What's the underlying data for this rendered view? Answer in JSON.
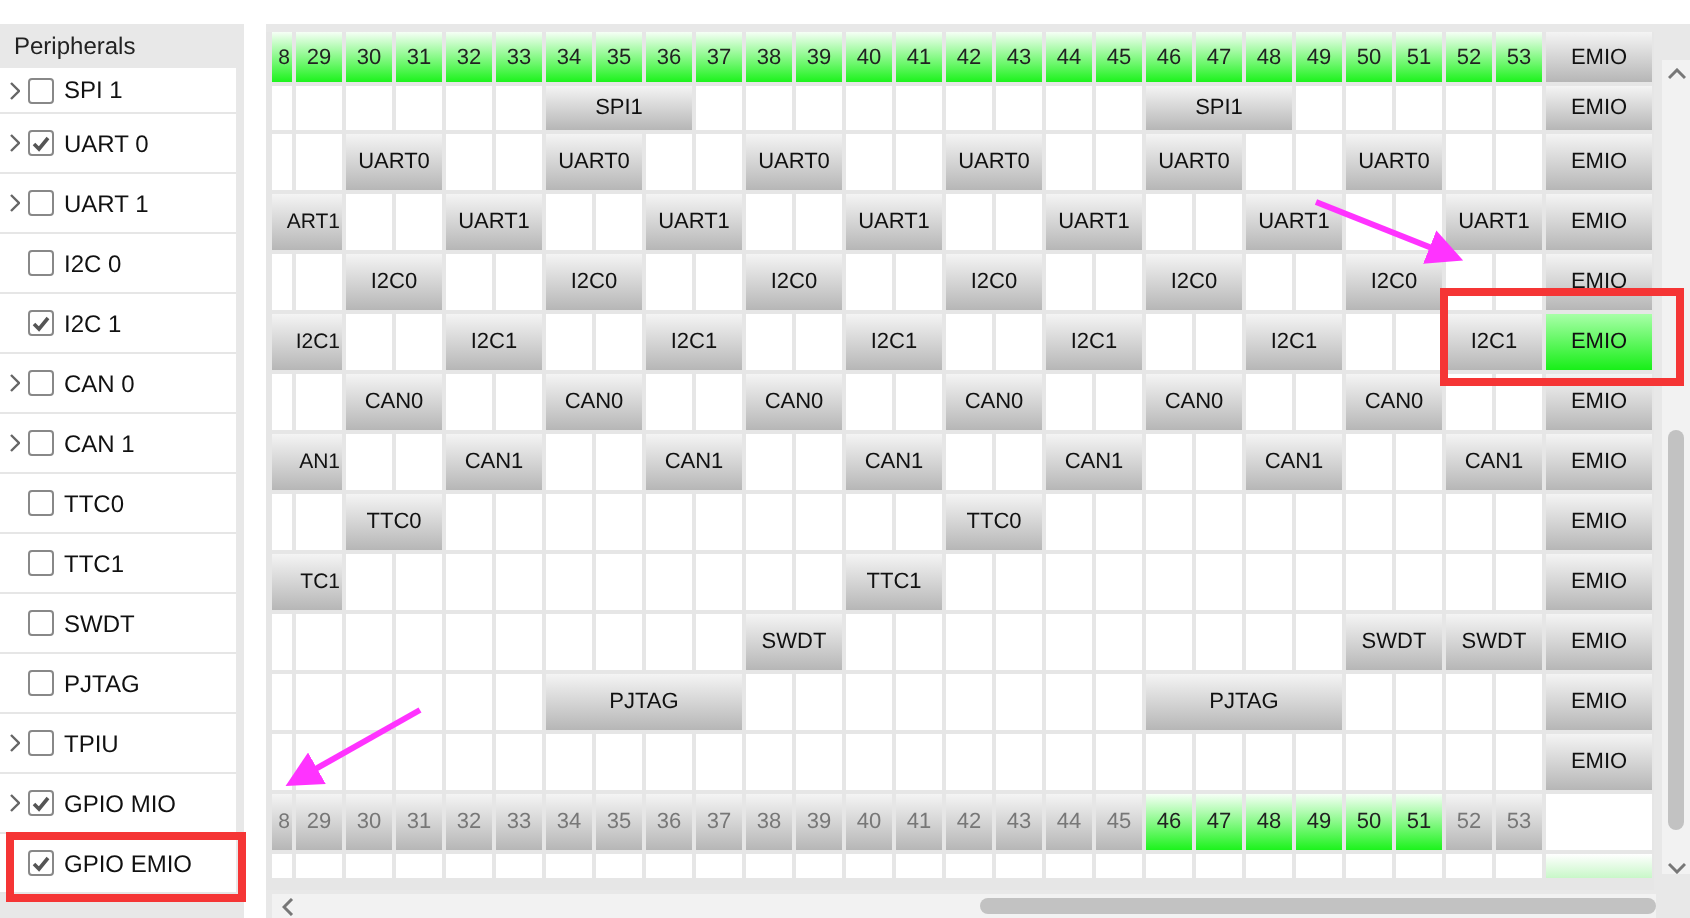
{
  "peripherals": {
    "title": "Peripherals",
    "items": [
      {
        "label": "SPI 1",
        "expandable": true,
        "checked": false
      },
      {
        "label": "UART 0",
        "expandable": true,
        "checked": true
      },
      {
        "label": "UART 1",
        "expandable": true,
        "checked": false
      },
      {
        "label": "I2C 0",
        "expandable": false,
        "checked": false
      },
      {
        "label": "I2C 1",
        "expandable": false,
        "checked": true
      },
      {
        "label": "CAN 0",
        "expandable": true,
        "checked": false
      },
      {
        "label": "CAN 1",
        "expandable": true,
        "checked": false
      },
      {
        "label": "TTC0",
        "expandable": false,
        "checked": false
      },
      {
        "label": "TTC1",
        "expandable": false,
        "checked": false
      },
      {
        "label": "SWDT",
        "expandable": false,
        "checked": false
      },
      {
        "label": "PJTAG",
        "expandable": false,
        "checked": false
      },
      {
        "label": "TPIU",
        "expandable": true,
        "checked": false
      },
      {
        "label": "GPIO MIO",
        "expandable": true,
        "checked": true
      },
      {
        "label": "GPIO EMIO",
        "expandable": false,
        "checked": true
      }
    ]
  },
  "pin_grid": {
    "top_pins": [
      {
        "label": "8",
        "active": true
      },
      {
        "label": "29",
        "active": true
      },
      {
        "label": "30",
        "active": true
      },
      {
        "label": "31",
        "active": true
      },
      {
        "label": "32",
        "active": true
      },
      {
        "label": "33",
        "active": true
      },
      {
        "label": "34",
        "active": true
      },
      {
        "label": "35",
        "active": true
      },
      {
        "label": "36",
        "active": true
      },
      {
        "label": "37",
        "active": true
      },
      {
        "label": "38",
        "active": true
      },
      {
        "label": "39",
        "active": true
      },
      {
        "label": "40",
        "active": true
      },
      {
        "label": "41",
        "active": true
      },
      {
        "label": "42",
        "active": true
      },
      {
        "label": "43",
        "active": true
      },
      {
        "label": "44",
        "active": true
      },
      {
        "label": "45",
        "active": true
      },
      {
        "label": "46",
        "active": true
      },
      {
        "label": "47",
        "active": true
      },
      {
        "label": "48",
        "active": true
      },
      {
        "label": "49",
        "active": true
      },
      {
        "label": "50",
        "active": true
      },
      {
        "label": "51",
        "active": true
      },
      {
        "label": "52",
        "active": true
      },
      {
        "label": "53",
        "active": true
      }
    ],
    "top_emio": {
      "label": "EMIO",
      "active": false
    },
    "rows": [
      {
        "cells": [
          {
            "kind": "empty"
          },
          {
            "kind": "empty"
          },
          {
            "kind": "empty"
          },
          {
            "kind": "empty"
          },
          {
            "kind": "empty"
          },
          {
            "kind": "empty"
          },
          {
            "kind": "function",
            "label": "SPI1"
          },
          {
            "kind": "continued"
          },
          {
            "kind": "continued"
          },
          {
            "kind": "empty"
          },
          {
            "kind": "empty"
          },
          {
            "kind": "empty"
          },
          {
            "kind": "empty"
          },
          {
            "kind": "empty"
          },
          {
            "kind": "empty"
          },
          {
            "kind": "empty"
          },
          {
            "kind": "empty"
          },
          {
            "kind": "empty"
          },
          {
            "kind": "function",
            "label": "SPI1"
          },
          {
            "kind": "continued"
          },
          {
            "kind": "continued"
          },
          {
            "kind": "empty"
          },
          {
            "kind": "empty"
          },
          {
            "kind": "empty"
          },
          {
            "kind": "empty"
          },
          {
            "kind": "empty"
          }
        ],
        "emio": {
          "label": "EMIO",
          "active": false
        }
      },
      {
        "cells": [
          {
            "kind": "empty"
          },
          {
            "kind": "empty"
          },
          {
            "kind": "function",
            "label": "UART0"
          },
          {
            "kind": "continued"
          },
          {
            "kind": "empty"
          },
          {
            "kind": "empty"
          },
          {
            "kind": "function",
            "label": "UART0"
          },
          {
            "kind": "continued"
          },
          {
            "kind": "empty"
          },
          {
            "kind": "empty"
          },
          {
            "kind": "function",
            "label": "UART0"
          },
          {
            "kind": "continued"
          },
          {
            "kind": "empty"
          },
          {
            "kind": "empty"
          },
          {
            "kind": "function",
            "label": "UART0"
          },
          {
            "kind": "continued"
          },
          {
            "kind": "empty"
          },
          {
            "kind": "empty"
          },
          {
            "kind": "function",
            "label": "UART0"
          },
          {
            "kind": "continued"
          },
          {
            "kind": "empty"
          },
          {
            "kind": "empty"
          },
          {
            "kind": "function",
            "label": "UART0"
          },
          {
            "kind": "continued"
          },
          {
            "kind": "empty"
          },
          {
            "kind": "empty"
          }
        ],
        "emio": {
          "label": "EMIO",
          "active": false
        }
      },
      {
        "cells": [
          {
            "kind": "function",
            "label": "ART1"
          },
          {
            "kind": "continued"
          },
          {
            "kind": "empty"
          },
          {
            "kind": "empty"
          },
          {
            "kind": "function",
            "label": "UART1"
          },
          {
            "kind": "continued"
          },
          {
            "kind": "empty"
          },
          {
            "kind": "empty"
          },
          {
            "kind": "function",
            "label": "UART1"
          },
          {
            "kind": "continued"
          },
          {
            "kind": "empty"
          },
          {
            "kind": "empty"
          },
          {
            "kind": "function",
            "label": "UART1"
          },
          {
            "kind": "continued"
          },
          {
            "kind": "empty"
          },
          {
            "kind": "empty"
          },
          {
            "kind": "function",
            "label": "UART1"
          },
          {
            "kind": "continued"
          },
          {
            "kind": "empty"
          },
          {
            "kind": "empty"
          },
          {
            "kind": "function",
            "label": "UART1"
          },
          {
            "kind": "continued"
          },
          {
            "kind": "empty"
          },
          {
            "kind": "empty"
          },
          {
            "kind": "function",
            "label": "UART1"
          },
          {
            "kind": "continued"
          }
        ],
        "emio": {
          "label": "EMIO",
          "active": false
        }
      },
      {
        "cells": [
          {
            "kind": "empty"
          },
          {
            "kind": "empty"
          },
          {
            "kind": "function",
            "label": "I2C0"
          },
          {
            "kind": "continued"
          },
          {
            "kind": "empty"
          },
          {
            "kind": "empty"
          },
          {
            "kind": "function",
            "label": "I2C0"
          },
          {
            "kind": "continued"
          },
          {
            "kind": "empty"
          },
          {
            "kind": "empty"
          },
          {
            "kind": "function",
            "label": "I2C0"
          },
          {
            "kind": "continued"
          },
          {
            "kind": "empty"
          },
          {
            "kind": "empty"
          },
          {
            "kind": "function",
            "label": "I2C0"
          },
          {
            "kind": "continued"
          },
          {
            "kind": "empty"
          },
          {
            "kind": "empty"
          },
          {
            "kind": "function",
            "label": "I2C0"
          },
          {
            "kind": "continued"
          },
          {
            "kind": "empty"
          },
          {
            "kind": "empty"
          },
          {
            "kind": "function",
            "label": "I2C0"
          },
          {
            "kind": "continued"
          },
          {
            "kind": "empty"
          },
          {
            "kind": "empty"
          }
        ],
        "emio": {
          "label": "EMIO",
          "active": false
        }
      },
      {
        "cells": [
          {
            "kind": "function",
            "label": "I2C1"
          },
          {
            "kind": "continued"
          },
          {
            "kind": "empty"
          },
          {
            "kind": "empty"
          },
          {
            "kind": "function",
            "label": "I2C1"
          },
          {
            "kind": "continued"
          },
          {
            "kind": "empty"
          },
          {
            "kind": "empty"
          },
          {
            "kind": "function",
            "label": "I2C1"
          },
          {
            "kind": "continued"
          },
          {
            "kind": "empty"
          },
          {
            "kind": "empty"
          },
          {
            "kind": "function",
            "label": "I2C1"
          },
          {
            "kind": "continued"
          },
          {
            "kind": "empty"
          },
          {
            "kind": "empty"
          },
          {
            "kind": "function",
            "label": "I2C1"
          },
          {
            "kind": "continued"
          },
          {
            "kind": "empty"
          },
          {
            "kind": "empty"
          },
          {
            "kind": "function",
            "label": "I2C1"
          },
          {
            "kind": "continued"
          },
          {
            "kind": "empty"
          },
          {
            "kind": "empty"
          },
          {
            "kind": "function",
            "label": "I2C1"
          },
          {
            "kind": "continued"
          }
        ],
        "emio": {
          "label": "EMIO",
          "active": true
        }
      },
      {
        "cells": [
          {
            "kind": "empty"
          },
          {
            "kind": "empty"
          },
          {
            "kind": "function",
            "label": "CAN0"
          },
          {
            "kind": "continued"
          },
          {
            "kind": "empty"
          },
          {
            "kind": "empty"
          },
          {
            "kind": "function",
            "label": "CAN0"
          },
          {
            "kind": "continued"
          },
          {
            "kind": "empty"
          },
          {
            "kind": "empty"
          },
          {
            "kind": "function",
            "label": "CAN0"
          },
          {
            "kind": "continued"
          },
          {
            "kind": "empty"
          },
          {
            "kind": "empty"
          },
          {
            "kind": "function",
            "label": "CAN0"
          },
          {
            "kind": "continued"
          },
          {
            "kind": "empty"
          },
          {
            "kind": "empty"
          },
          {
            "kind": "function",
            "label": "CAN0"
          },
          {
            "kind": "continued"
          },
          {
            "kind": "empty"
          },
          {
            "kind": "empty"
          },
          {
            "kind": "function",
            "label": "CAN0"
          },
          {
            "kind": "continued"
          },
          {
            "kind": "empty"
          },
          {
            "kind": "empty"
          }
        ],
        "emio": {
          "label": "EMIO",
          "active": false
        }
      },
      {
        "cells": [
          {
            "kind": "function",
            "label": "AN1"
          },
          {
            "kind": "continued"
          },
          {
            "kind": "empty"
          },
          {
            "kind": "empty"
          },
          {
            "kind": "function",
            "label": "CAN1"
          },
          {
            "kind": "continued"
          },
          {
            "kind": "empty"
          },
          {
            "kind": "empty"
          },
          {
            "kind": "function",
            "label": "CAN1"
          },
          {
            "kind": "continued"
          },
          {
            "kind": "empty"
          },
          {
            "kind": "empty"
          },
          {
            "kind": "function",
            "label": "CAN1"
          },
          {
            "kind": "continued"
          },
          {
            "kind": "empty"
          },
          {
            "kind": "empty"
          },
          {
            "kind": "function",
            "label": "CAN1"
          },
          {
            "kind": "continued"
          },
          {
            "kind": "empty"
          },
          {
            "kind": "empty"
          },
          {
            "kind": "function",
            "label": "CAN1"
          },
          {
            "kind": "continued"
          },
          {
            "kind": "empty"
          },
          {
            "kind": "empty"
          },
          {
            "kind": "function",
            "label": "CAN1"
          },
          {
            "kind": "continued"
          }
        ],
        "emio": {
          "label": "EMIO",
          "active": false
        }
      },
      {
        "cells": [
          {
            "kind": "empty"
          },
          {
            "kind": "empty"
          },
          {
            "kind": "function",
            "label": "TTC0"
          },
          {
            "kind": "continued"
          },
          {
            "kind": "empty"
          },
          {
            "kind": "empty"
          },
          {
            "kind": "empty"
          },
          {
            "kind": "empty"
          },
          {
            "kind": "empty"
          },
          {
            "kind": "empty"
          },
          {
            "kind": "empty"
          },
          {
            "kind": "empty"
          },
          {
            "kind": "empty"
          },
          {
            "kind": "empty"
          },
          {
            "kind": "function",
            "label": "TTC0"
          },
          {
            "kind": "continued"
          },
          {
            "kind": "empty"
          },
          {
            "kind": "empty"
          },
          {
            "kind": "empty"
          },
          {
            "kind": "empty"
          },
          {
            "kind": "empty"
          },
          {
            "kind": "empty"
          },
          {
            "kind": "empty"
          },
          {
            "kind": "empty"
          },
          {
            "kind": "empty"
          },
          {
            "kind": "empty"
          }
        ],
        "emio": {
          "label": "EMIO",
          "active": false
        }
      },
      {
        "cells": [
          {
            "kind": "function",
            "label": "TC1"
          },
          {
            "kind": "continued"
          },
          {
            "kind": "empty"
          },
          {
            "kind": "empty"
          },
          {
            "kind": "empty"
          },
          {
            "kind": "empty"
          },
          {
            "kind": "empty"
          },
          {
            "kind": "empty"
          },
          {
            "kind": "empty"
          },
          {
            "kind": "empty"
          },
          {
            "kind": "empty"
          },
          {
            "kind": "empty"
          },
          {
            "kind": "function",
            "label": "TTC1"
          },
          {
            "kind": "continued"
          },
          {
            "kind": "empty"
          },
          {
            "kind": "empty"
          },
          {
            "kind": "empty"
          },
          {
            "kind": "empty"
          },
          {
            "kind": "empty"
          },
          {
            "kind": "empty"
          },
          {
            "kind": "empty"
          },
          {
            "kind": "empty"
          },
          {
            "kind": "empty"
          },
          {
            "kind": "empty"
          },
          {
            "kind": "empty"
          },
          {
            "kind": "empty"
          }
        ],
        "emio": {
          "label": "EMIO",
          "active": false
        }
      },
      {
        "cells": [
          {
            "kind": "empty"
          },
          {
            "kind": "empty"
          },
          {
            "kind": "empty"
          },
          {
            "kind": "empty"
          },
          {
            "kind": "empty"
          },
          {
            "kind": "empty"
          },
          {
            "kind": "empty"
          },
          {
            "kind": "empty"
          },
          {
            "kind": "empty"
          },
          {
            "kind": "empty"
          },
          {
            "kind": "function",
            "label": "SWDT"
          },
          {
            "kind": "continued"
          },
          {
            "kind": "empty"
          },
          {
            "kind": "empty"
          },
          {
            "kind": "empty"
          },
          {
            "kind": "empty"
          },
          {
            "kind": "empty"
          },
          {
            "kind": "empty"
          },
          {
            "kind": "empty"
          },
          {
            "kind": "empty"
          },
          {
            "kind": "empty"
          },
          {
            "kind": "empty"
          },
          {
            "kind": "function",
            "label": "SWDT"
          },
          {
            "kind": "continued"
          },
          {
            "kind": "function",
            "label": "SWDT"
          },
          {
            "kind": "continued"
          }
        ],
        "emio": {
          "label": "EMIO",
          "active": false
        }
      },
      {
        "cells": [
          {
            "kind": "empty"
          },
          {
            "kind": "empty"
          },
          {
            "kind": "empty"
          },
          {
            "kind": "empty"
          },
          {
            "kind": "empty"
          },
          {
            "kind": "empty"
          },
          {
            "kind": "function",
            "label": "PJTAG"
          },
          {
            "kind": "continued"
          },
          {
            "kind": "continued"
          },
          {
            "kind": "continued"
          },
          {
            "kind": "empty"
          },
          {
            "kind": "empty"
          },
          {
            "kind": "empty"
          },
          {
            "kind": "empty"
          },
          {
            "kind": "empty"
          },
          {
            "kind": "empty"
          },
          {
            "kind": "empty"
          },
          {
            "kind": "empty"
          },
          {
            "kind": "function",
            "label": "PJTAG"
          },
          {
            "kind": "continued"
          },
          {
            "kind": "continued"
          },
          {
            "kind": "continued"
          },
          {
            "kind": "empty"
          },
          {
            "kind": "empty"
          },
          {
            "kind": "empty"
          },
          {
            "kind": "empty"
          }
        ],
        "emio": {
          "label": "EMIO",
          "active": false
        }
      },
      {
        "cells": [
          {
            "kind": "empty"
          },
          {
            "kind": "empty"
          },
          {
            "kind": "empty"
          },
          {
            "kind": "empty"
          },
          {
            "kind": "empty"
          },
          {
            "kind": "empty"
          },
          {
            "kind": "empty"
          },
          {
            "kind": "empty"
          },
          {
            "kind": "empty"
          },
          {
            "kind": "empty"
          },
          {
            "kind": "empty"
          },
          {
            "kind": "empty"
          },
          {
            "kind": "empty"
          },
          {
            "kind": "empty"
          },
          {
            "kind": "empty"
          },
          {
            "kind": "empty"
          },
          {
            "kind": "empty"
          },
          {
            "kind": "empty"
          },
          {
            "kind": "empty"
          },
          {
            "kind": "empty"
          },
          {
            "kind": "empty"
          },
          {
            "kind": "empty"
          },
          {
            "kind": "empty"
          },
          {
            "kind": "empty"
          },
          {
            "kind": "empty"
          },
          {
            "kind": "empty"
          }
        ],
        "emio": {
          "label": "EMIO",
          "active": false
        }
      }
    ],
    "bottom_pins": [
      {
        "label": "8",
        "active": false
      },
      {
        "label": "29",
        "active": false
      },
      {
        "label": "30",
        "active": false
      },
      {
        "label": "31",
        "active": false
      },
      {
        "label": "32",
        "active": false
      },
      {
        "label": "33",
        "active": false
      },
      {
        "label": "34",
        "active": false
      },
      {
        "label": "35",
        "active": false
      },
      {
        "label": "36",
        "active": false
      },
      {
        "label": "37",
        "active": false
      },
      {
        "label": "38",
        "active": false
      },
      {
        "label": "39",
        "active": false
      },
      {
        "label": "40",
        "active": false
      },
      {
        "label": "41",
        "active": false
      },
      {
        "label": "42",
        "active": false
      },
      {
        "label": "43",
        "active": false
      },
      {
        "label": "44",
        "active": false
      },
      {
        "label": "45",
        "active": false
      },
      {
        "label": "46",
        "active": true
      },
      {
        "label": "47",
        "active": true
      },
      {
        "label": "48",
        "active": true
      },
      {
        "label": "49",
        "active": true
      },
      {
        "label": "50",
        "active": true
      },
      {
        "label": "51",
        "active": true
      },
      {
        "label": "52",
        "active": false
      },
      {
        "label": "53",
        "active": false
      }
    ],
    "next_row_emio": {
      "active": true
    }
  }
}
